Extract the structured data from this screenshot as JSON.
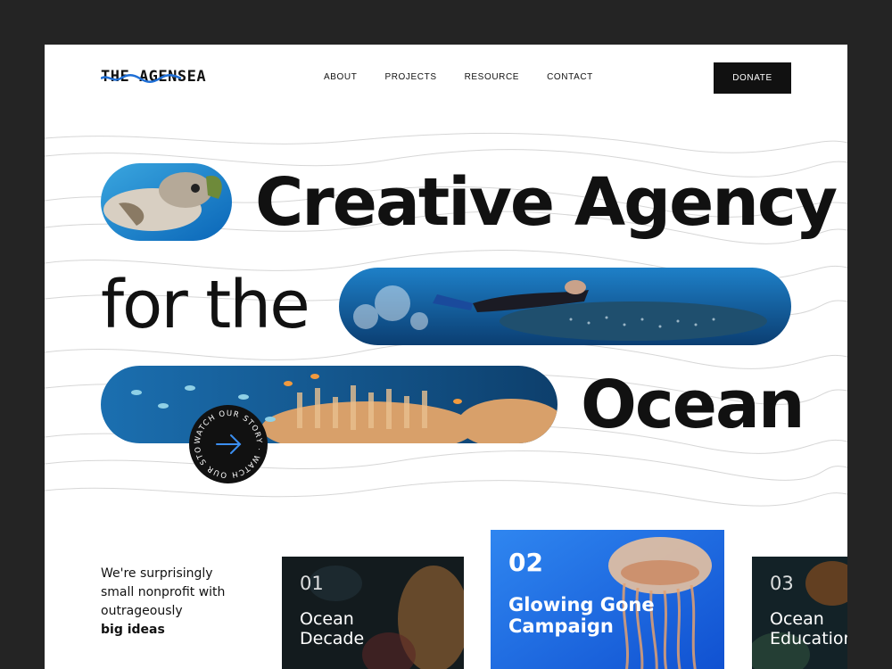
{
  "header": {
    "logo_text": "THE AGENSEA",
    "nav": [
      "ABOUT",
      "PROJECTS",
      "RESOURCE",
      "CONTACT"
    ],
    "donate_label": "DONATE"
  },
  "hero": {
    "line1": "Creative Agency",
    "line2": "for the",
    "line3": "Ocean",
    "watch_label": "WATCH OUR STORY · WATCH OUR STORY ·"
  },
  "intro": {
    "text": "We're surprisingly small nonprofit with outrageously",
    "emphasis": "big ideas"
  },
  "cards": [
    {
      "number": "01",
      "title_line1": "Ocean",
      "title_line2": "Decade"
    },
    {
      "number": "02",
      "title_line1": "Glowing Gone",
      "title_line2": "Campaign"
    },
    {
      "number": "03",
      "title_line1": "Ocean",
      "title_line2": "Education"
    }
  ],
  "colors": {
    "accent_blue": "#1f6fd6",
    "dark": "#111111",
    "frame": "#242424"
  }
}
